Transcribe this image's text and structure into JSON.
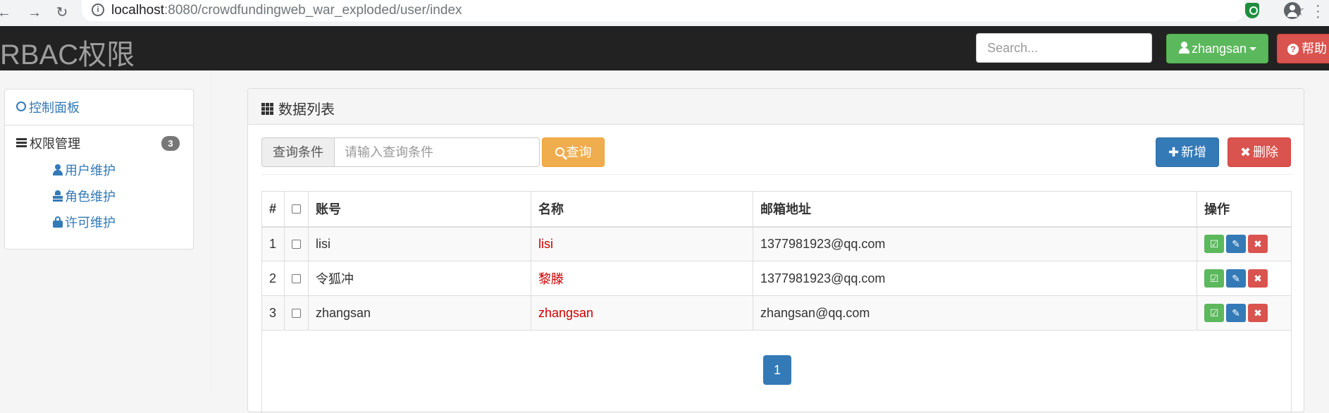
{
  "browser": {
    "url_host": "localhost",
    "url_path": ":8080/crowdfundingweb_war_exploded/user/index"
  },
  "navbar": {
    "brand": "RBAC权限",
    "search_placeholder": "Search...",
    "user_label": "zhangsan",
    "help_label": "帮助"
  },
  "sidebar": {
    "dashboard": "控制面板",
    "group_label": "权限管理",
    "group_badge": "3",
    "items": [
      {
        "label": "用户维护",
        "icon": "user-icon"
      },
      {
        "label": "角色维护",
        "icon": "role-icon"
      },
      {
        "label": "许可维护",
        "icon": "lock-icon"
      }
    ]
  },
  "main": {
    "panel_title": "数据列表",
    "query_addon": "查询条件",
    "query_placeholder": "请输入查询条件",
    "query_button": "查询",
    "add_button": "新增",
    "delete_button": "删除",
    "columns": [
      "#",
      "",
      "账号",
      "名称",
      "邮箱地址",
      "操作"
    ],
    "rows": [
      {
        "no": "1",
        "account": "lisi",
        "name": "lisi",
        "email": "1377981923@qq.com"
      },
      {
        "no": "2",
        "account": "令狐冲",
        "name": "黎滕",
        "email": "1377981923@qq.com"
      },
      {
        "no": "3",
        "account": "zhangsan",
        "name": "zhangsan",
        "email": "zhangsan@qq.com"
      }
    ],
    "page": "1"
  },
  "colors": {
    "primary": "#337ab7",
    "success": "#5cb85c",
    "danger": "#d9534f",
    "warning": "#f0ad4e",
    "navbar": "#222222"
  }
}
